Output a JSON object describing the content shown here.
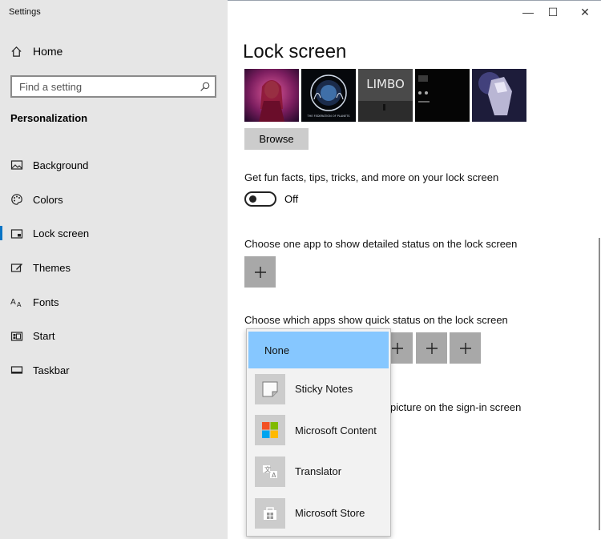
{
  "window": {
    "title": "Settings",
    "minimize_glyph": "—",
    "maximize_glyph": "☐",
    "close_glyph": "✕"
  },
  "sidebar": {
    "home_label": "Home",
    "search_placeholder": "Find a setting",
    "section_title": "Personalization",
    "items": [
      {
        "label": "Background",
        "icon": "background-icon"
      },
      {
        "label": "Colors",
        "icon": "palette-icon"
      },
      {
        "label": "Lock screen",
        "icon": "lock-screen-icon",
        "active": true
      },
      {
        "label": "Themes",
        "icon": "themes-icon"
      },
      {
        "label": "Fonts",
        "icon": "fonts-icon"
      },
      {
        "label": "Start",
        "icon": "start-icon"
      },
      {
        "label": "Taskbar",
        "icon": "taskbar-icon"
      }
    ]
  },
  "main": {
    "title": "Lock screen",
    "browse_label": "Browse",
    "fun_facts_label": "Get fun facts, tips, tricks, and more on your lock screen",
    "toggle_state": "Off",
    "detailed_status_label": "Choose one app to show detailed status on the lock screen",
    "quick_status_label": "Choose which apps show quick status on the lock screen",
    "signin_partial_label": "picture on the sign-in screen",
    "thumbnails": [
      {
        "name": "thumbnail-scarlet-witch"
      },
      {
        "name": "thumbnail-federation-seal",
        "caption": "THE FEDERATION OF PLANETS"
      },
      {
        "name": "thumbnail-limbo",
        "caption": "LIMBO"
      },
      {
        "name": "thumbnail-dark-phone"
      },
      {
        "name": "thumbnail-armored-figure"
      }
    ]
  },
  "dropdown": {
    "items": [
      {
        "label": "None",
        "selected": true
      },
      {
        "label": "Sticky Notes",
        "icon": "sticky-notes-icon"
      },
      {
        "label": "Microsoft Content",
        "icon": "microsoft-logo-icon"
      },
      {
        "label": "Translator",
        "icon": "translator-icon"
      },
      {
        "label": "Microsoft Store",
        "icon": "store-icon"
      }
    ]
  },
  "colors": {
    "accent": "#0a74c5",
    "dropdown_selected": "#86c7ff",
    "sidebar_bg": "#e6e6e6",
    "tile_bg": "#a8a8a8"
  }
}
